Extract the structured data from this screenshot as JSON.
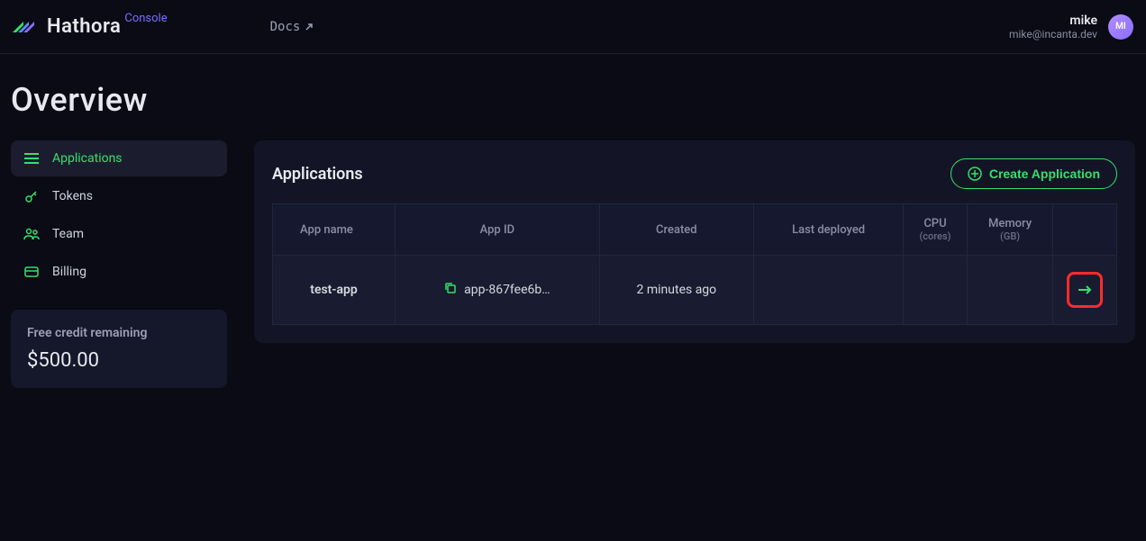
{
  "header": {
    "brand": "Hathora",
    "console_label": "Console",
    "docs_label": "Docs",
    "user_name": "mike",
    "user_email": "mike@incanta.dev",
    "avatar_initials": "MI"
  },
  "page": {
    "title": "Overview"
  },
  "sidebar": {
    "items": [
      {
        "id": "applications",
        "label": "Applications",
        "active": true
      },
      {
        "id": "tokens",
        "label": "Tokens",
        "active": false
      },
      {
        "id": "team",
        "label": "Team",
        "active": false
      },
      {
        "id": "billing",
        "label": "Billing",
        "active": false
      }
    ],
    "credit": {
      "label": "Free credit remaining",
      "amount": "$500.00"
    }
  },
  "panel": {
    "title": "Applications",
    "create_button": "Create Application",
    "columns": {
      "app_name": "App name",
      "app_id": "App ID",
      "created": "Created",
      "last_deployed": "Last deployed",
      "cpu": "CPU",
      "cpu_sub": "(cores)",
      "memory": "Memory",
      "memory_sub": "(GB)"
    },
    "rows": [
      {
        "app_name": "test-app",
        "app_id": "app-867fee6b…",
        "created": "2 minutes ago",
        "last_deployed": "",
        "cpu": "",
        "memory": ""
      }
    ]
  }
}
